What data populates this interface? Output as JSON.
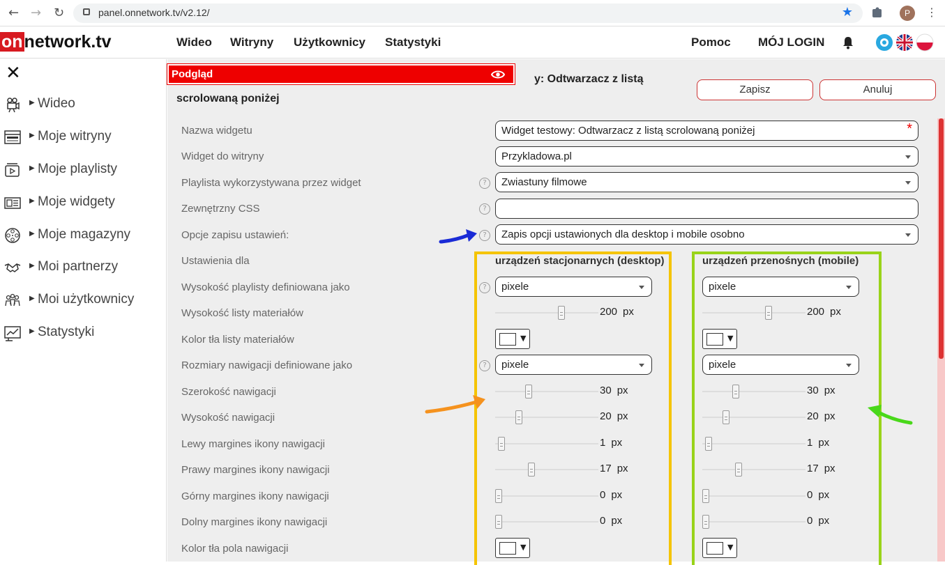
{
  "browser": {
    "url": "panel.onnetwork.tv/v2.12/",
    "profile_initial": "P"
  },
  "header": {
    "logo_on": "on",
    "logo_rest": "network.tv",
    "nav": [
      "Wideo",
      "Witryny",
      "Użytkownicy",
      "Statystyki"
    ],
    "help": "Pomoc",
    "login": "MÓJ LOGIN"
  },
  "sidebar": {
    "items": [
      {
        "label": "Wideo",
        "icon": "camera-icon"
      },
      {
        "label": "Moje witryny",
        "icon": "website-icon"
      },
      {
        "label": "Moje playlisty",
        "icon": "playlist-icon"
      },
      {
        "label": "Moje widgety",
        "icon": "widget-icon"
      },
      {
        "label": "Moje magazyny",
        "icon": "film-reel-icon"
      },
      {
        "label": "Moi partnerzy",
        "icon": "handshake-icon"
      },
      {
        "label": "Moi użytkownicy",
        "icon": "users-icon"
      },
      {
        "label": "Statystyki",
        "icon": "stats-icon"
      }
    ]
  },
  "main": {
    "preview_label": "Podgląd",
    "title_line1": "y: Odtwarzacz z listą",
    "title_line2": "scrolowaną poniżej",
    "save_label": "Zapisz",
    "cancel_label": "Anuluj",
    "form": {
      "widget_name_label": "Nazwa widgetu",
      "widget_name_value": "Widget testowy: Odtwarzacz z listą scrolowaną poniżej",
      "site_label": "Widget do witryny",
      "site_value": "Przykladowa.pl",
      "playlist_label": "Playlista wykorzystywana przez widget",
      "playlist_value": "Zwiastuny filmowe",
      "css_label": "Zewnętrzny CSS",
      "css_value": "",
      "save_options_label": "Opcje zapisu ustawień:",
      "save_options_value": "Zapis opcji ustawionych dla desktop i mobile osobno",
      "settings_for_label": "Ustawienia dla",
      "desktop_header": "urządzeń stacjonarnych (desktop)",
      "mobile_header": "urządzeń przenośnych (mobile)"
    },
    "rows": [
      {
        "label": "Wysokość playlisty definiowana jako",
        "type": "select",
        "desktop": "pixele",
        "mobile": "pixele"
      },
      {
        "label": "Wysokość listy materiałów",
        "type": "slider",
        "desktop": "200",
        "mobile": "200",
        "desktop_level": 0.65,
        "mobile_level": 0.65,
        "unit": "px"
      },
      {
        "label": "Kolor tła listy materiałów",
        "type": "color"
      },
      {
        "label": "Rozmiary nawigacji definiowane jako",
        "type": "select",
        "desktop": "pixele",
        "mobile": "pixele"
      },
      {
        "label": "Szerokość nawigacji",
        "type": "slider",
        "desktop": "30",
        "mobile": "30",
        "desktop_level": 0.31,
        "mobile_level": 0.31,
        "unit": "px"
      },
      {
        "label": "Wysokość nawigacji",
        "type": "slider",
        "desktop": "20",
        "mobile": "20",
        "desktop_level": 0.21,
        "mobile_level": 0.21,
        "unit": "px"
      },
      {
        "label": "Lewy margines ikony nawigacji",
        "type": "slider",
        "desktop": "1",
        "mobile": "1",
        "desktop_level": 0.03,
        "mobile_level": 0.03,
        "unit": "px"
      },
      {
        "label": "Prawy margines ikony nawigacji",
        "type": "slider",
        "desktop": "17",
        "mobile": "17",
        "desktop_level": 0.34,
        "mobile_level": 0.34,
        "unit": "px"
      },
      {
        "label": "Górny margines ikony nawigacji",
        "type": "slider",
        "desktop": "0",
        "mobile": "0",
        "desktop_level": 0.0,
        "mobile_level": 0.0,
        "unit": "px"
      },
      {
        "label": "Dolny margines ikony nawigacji",
        "type": "slider",
        "desktop": "0",
        "mobile": "0",
        "desktop_level": 0.0,
        "mobile_level": 0.0,
        "unit": "px"
      },
      {
        "label": "Kolor tła pola nawigacji",
        "type": "color"
      }
    ]
  },
  "colors": {
    "brand": "#d71920",
    "desktop_box": "#f5c400",
    "mobile_box": "#99d31a",
    "arrow_blue": "#1a2bd6",
    "arrow_orange": "#f5921e",
    "arrow_green": "#49d81a"
  }
}
